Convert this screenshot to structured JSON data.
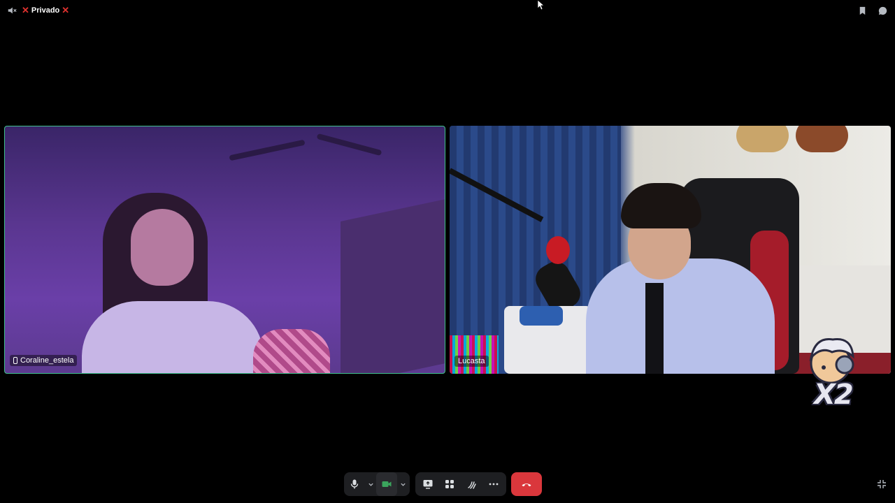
{
  "window": {
    "title": "Privado",
    "status_mark": "✕"
  },
  "participants": [
    {
      "name": "Coraline_estela",
      "device": "mobile",
      "speaking": true
    },
    {
      "name": "Lucasta",
      "device": "desktop",
      "speaking": false
    }
  ],
  "overlay": {
    "sticker_text": "X2"
  },
  "controls": {
    "microphone": "microphone-icon",
    "camera": "camera-icon",
    "screen_share": "screen-share-icon",
    "activities": "activities-icon",
    "soundboard": "soundboard-icon",
    "more": "more-icon",
    "disconnect": "disconnect-icon"
  },
  "colors": {
    "speaking_border": "#3fbf8c",
    "hangup": "#da373c",
    "camera_active": "#3ba55d",
    "title_mark": "#e0322f"
  }
}
